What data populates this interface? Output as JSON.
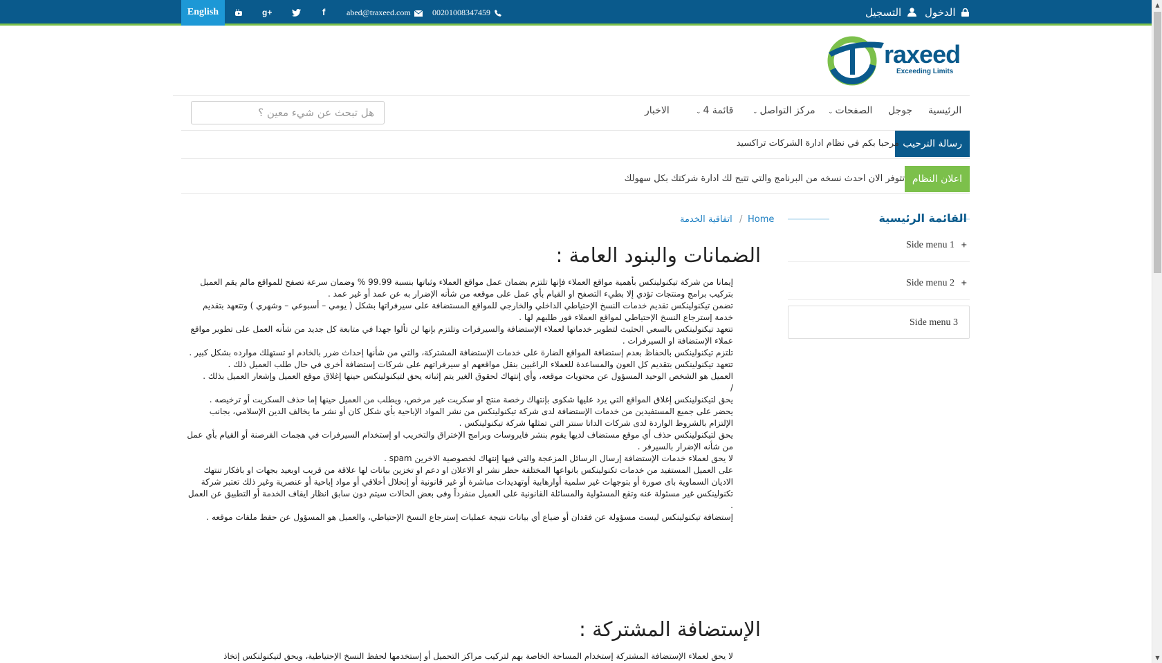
{
  "topbar": {
    "language": "English",
    "email": "abed@traxeed.com",
    "phone": "00201008347459",
    "login": "الدخول",
    "register": "التسجيل"
  },
  "logo": {
    "name": "raxeed",
    "tagline": "Exceeding Limits"
  },
  "nav": {
    "items": [
      "الرئيسية",
      "جوجل",
      "الصفحات",
      "مركز التواصل",
      "قائمة 4",
      "الاخبار"
    ],
    "search_placeholder": "هل تبحث عن شيء معين ؟"
  },
  "announcements": [
    {
      "tag": "رسالة الترحيب",
      "message": "مرحبا بكم في نظام ادارة الشركات تراكسيد",
      "color": "#0a5a8c"
    },
    {
      "tag": "اعلان النظام",
      "message": "تتوفر الان احدث نسخه من البرنامج والتي تتيح لك ادارة شركتك بكل سهولك",
      "color": "#7cc04b"
    }
  ],
  "sidebar": {
    "title": "القائمة الرئيسية",
    "items": [
      "Side menu 1",
      "Side menu 2",
      "Side menu 3"
    ]
  },
  "breadcrumb": {
    "home": "Home",
    "separator": "/",
    "current": "اتفاقية الخدمة"
  },
  "section1": {
    "title": "الضمانات والبنود العامة :",
    "paragraphs": [
      "إيمانا من شركة تيكنولينكس بأهمية مواقع العملاء فإنها تلتزم بضمان عمل مواقع العملاء وثباتها بنسبة 99.99 % وضمان سرعة تصفح للمواقع مالم يقم العميل بتركيب برامج ومنتجات تؤدي إلا بطيء التصفح او القيام بأي عمل على موقعه من شأنه الإضرار به عن عمد أو غير عمد .",
      "تضمن تيكنولينكس تقديم خدمات النسخ الإحتياطي الداخلي والخارجي للمواقع المستضافة على سيرفراتها بشكل ( يومي – أسبوعي – وشهري ) وتتعهد بتقديم خدمة إسترجاع النسخ الإحتياطي لمواقع العملاء فور طلبهم لها .",
      "تتعهد تيكنولينكس بالسعي الحثيث لتطوير خدماتها لعملاء الإستضافة والسيرفرات وتلتزم بإنها لن تألوا جهدا في متابعة كل جديد من شأنه العمل على تطوير مواقع عملاء الإستضافة او السيرفرات .",
      "تلتزم تيكنولينكس بالحفاظ بعدم إستضافة المواقع الضارة على خدمات الإستضافة المشتركة، والتي من شأنها إحداث ضرر بالخادم او تستهلك موارده بشكل كبير .",
      "تتعهد تيكنولينكس بتقديم كل العون والمساعدة للعملاء الراغبين بنقل مواقعهم او سيرفراتهم على شركات إستضافة أخرى في حال طلب العميل ذلك .",
      "العميل هو الشخص الوحيد المسؤول عن محتويات موقعه، وأي إنتهاك لحقوق الغير يتم إثباته يحق لتيكنولينكس حينها إغلاق موقع العميل وإشعار العميل بذلك .",
      "/",
      "يحق لتيكنولينكس إغلاق المواقع التي يرد عليها شكوى بإنتهاك رخصة منتج او سكريت غير مرخص، ويطلب من العميل حينها إما حذف السكريت أو ترخيصه .",
      "يحضر على جميع المستفيدين من خدمات الإستضافة لدى شركة تيكنولينكس من نشر المواد الإباحية بأي شكل كان أو نشر ما يخالف الدين الإسلامي، بجانب الإلتزام بالشروط الواردة لدى شركات الداتا سنتر التي تمثلها شركة تيكنولينكس .",
      "يحق لتيكنولينكس حذف أي موقع مستضاف لديها يقوم بنشر فايروسات وبرامج الإختراق والتخريب او إستخدام السيرفرات في هجمات القرصنة أو القيام بأي عمل من شأنه الإضرار بالسيرفر .",
      "لا يحق لعملاء خدمات الإستضافة إرسال الرسائل المزعجة والتي فيها إنتهاك لخصوصية الاخرين spam .",
      "على العميل المستفيد من خدمات تكنولينكس بانواعها المختلفة حظر نشر او الاعلان او دعم او تخزين بيانات لها علاقة من قريب اوبعيد بجهات او بافكار تنتهك الاديان السماوية باى صورة أو بتوجهات غير سلمية أوارهابية أوتهديدات مباشرة أو غير قانونية أو إنحلال أخلاقي أو مواد إباحية أو عنصرية وغير ذلك تعتبر شركة تكنولينكس غير مسئولة عنه وتقع المسئولية والمسائلة القانونية على العميل منفرداً وفى بعض الحالات سيتم دون سابق انظار ايقاف الخدمة أو التطبيق عن العمل .",
      "إستضافة تيكنولينكس ليست مسؤولة عن فقدان أو ضياع أي بيانات نتيجة عمليات إسترجاع النسخ الإحتياطي، والعميل هو المسؤول عن حفظ ملفات موقعه ."
    ]
  },
  "section2": {
    "title": "الإستضافة المشتركة :",
    "first_line": "لا يحق لعملاء الإستضافة المشتركة إستخدام المساحة الخاصة بهم لتركيب مراكز التحميل أو إستخدمها لحفظ النسخ الإحتياطية، ويحق لتيكنولنكس إتخاذ"
  }
}
